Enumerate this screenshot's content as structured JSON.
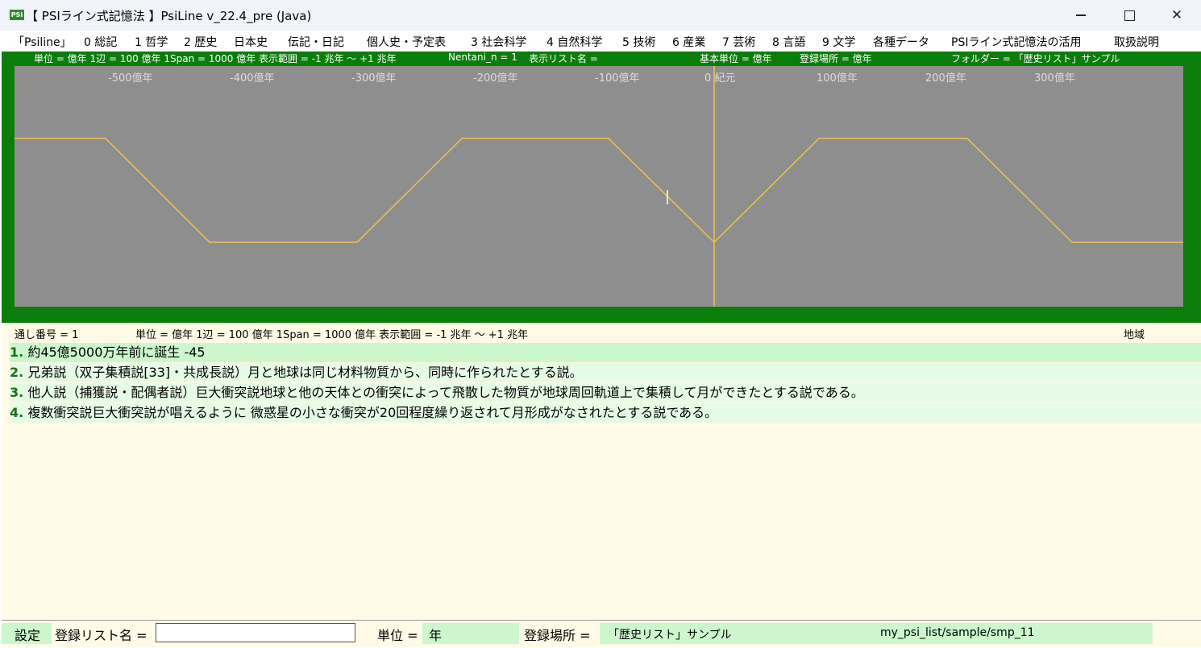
{
  "window": {
    "title": "【 PSIライン式記憶法 】PsiLine v_22.4_pre (Java)",
    "icon_label": "PSI"
  },
  "menu": [
    "「Psiline」",
    "0 総記",
    "1 哲学",
    "2 歴史",
    "日本史",
    "伝記・日記",
    "個人史・予定表",
    "3 社会科学",
    "4 自然科学",
    "5 技術",
    "6 産業",
    "7 芸術",
    "8 言語",
    "9 文学",
    "各種データ",
    "PSIライン式記憶法の活用",
    "取扱説明"
  ],
  "timeline_header": {
    "unit": "単位 = 億年  1辺 = 100 億年  1Span = 1000 億年  表示範囲 = -1 兆年 〜 +1 兆年",
    "nentani": "Nentani_n = 1",
    "display_list": "表示リスト名 =",
    "base_unit": "基本単位 = 億年",
    "reg_place": "登録場所 = 億年",
    "folder": "フォルダー = 「歴史リスト」サンプル"
  },
  "chart_data": {
    "type": "line",
    "x_unit": "億年",
    "ticks": [
      {
        "value": -500,
        "label": "-500億年"
      },
      {
        "value": -400,
        "label": "-400億年"
      },
      {
        "value": -300,
        "label": "-300億年"
      },
      {
        "value": -200,
        "label": "-200億年"
      },
      {
        "value": -100,
        "label": "-100億年"
      },
      {
        "value": 0,
        "label": "0 紀元"
      },
      {
        "value": 100,
        "label": "100億年"
      },
      {
        "value": 200,
        "label": "200億年"
      },
      {
        "value": 300,
        "label": "300億年"
      }
    ],
    "line_color": "#f2c14e",
    "plot_background": "#8e8e8e",
    "frame_color": "#0a7d0a"
  },
  "info_header": {
    "serial": "通し番号 = 1",
    "unit": "単位 = 億年  1辺 = 100 億年  1Span = 1000 億年  表示範囲 = -1 兆年 〜 +1 兆年",
    "region": "地域"
  },
  "items": [
    {
      "num": "1.",
      "text": "約45億5000万年前に誕生 -45",
      "bg": "#ccf7cc"
    },
    {
      "num": "2.",
      "text": "兄弟説（双子集積説[33]・共成長説）月と地球は同じ材料物質から、同時に作られたとする説。",
      "bg": "#e6fbe6"
    },
    {
      "num": "3.",
      "text": "他人説（捕獲説・配偶者説）巨大衝突説地球と他の天体との衝突によって飛散した物質が地球周回軌道上で集積して月ができたとする説である。",
      "bg": "#e6fbe6"
    },
    {
      "num": "4.",
      "text": "複数衝突説巨大衝突説が唱えるように 微惑星の小さな衝突が20回程度繰り返されて月形成がなされたとする説である。",
      "bg": "#e6fbe6"
    }
  ],
  "status": {
    "settings": "設定",
    "list_name_label": "登録リスト名 =",
    "list_name_value": "",
    "unit_label": "単位 =",
    "unit_value": "年",
    "place_label": "登録場所 =",
    "place_value": "「歴史リスト」サンプル",
    "path": "my_psi_list/sample/smp_11"
  }
}
